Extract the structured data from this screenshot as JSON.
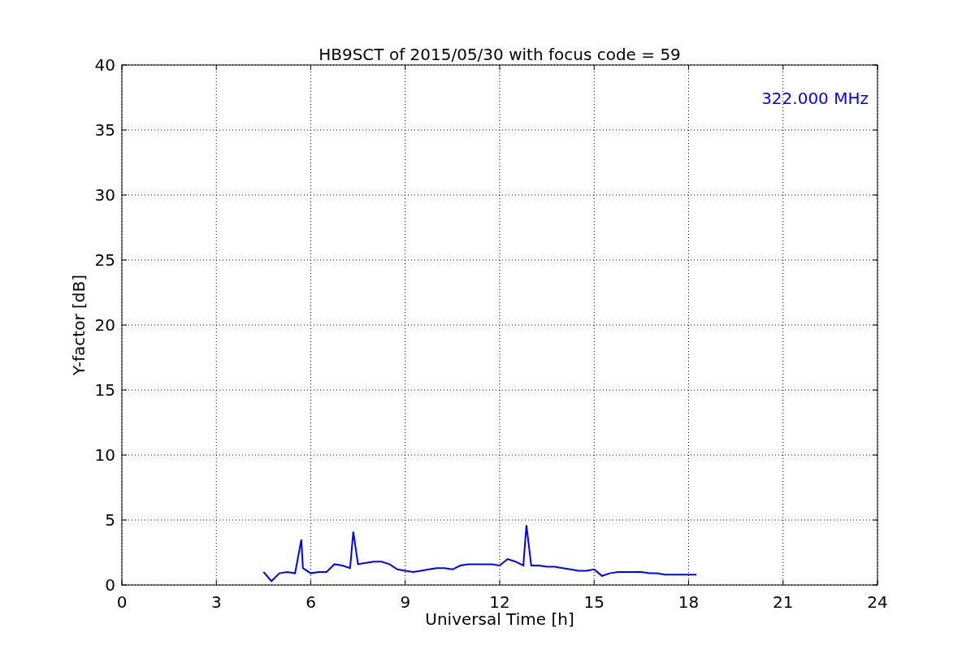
{
  "chart_data": {
    "type": "line",
    "title": "HB9SCT of 2015/05/30 with focus code = 59",
    "xlabel": "Universal Time [h]",
    "ylabel": "Y-factor [dB]",
    "x": [
      4.5,
      4.75,
      5.0,
      5.25,
      5.5,
      5.7,
      5.75,
      6.0,
      6.25,
      6.5,
      6.75,
      7.0,
      7.25,
      7.35,
      7.5,
      7.75,
      8.0,
      8.25,
      8.5,
      8.75,
      9.0,
      9.25,
      9.5,
      9.75,
      10.0,
      10.25,
      10.5,
      10.75,
      11.0,
      11.25,
      11.5,
      11.75,
      12.0,
      12.25,
      12.5,
      12.75,
      12.85,
      13.0,
      13.25,
      13.5,
      13.75,
      14.0,
      14.25,
      14.5,
      14.75,
      15.0,
      15.25,
      15.5,
      15.75,
      16.0,
      16.25,
      16.5,
      16.75,
      17.0,
      17.25,
      17.5,
      17.75,
      18.0,
      18.25
    ],
    "series": [
      {
        "name": "322.000 MHz",
        "color": "#0000ff",
        "values": [
          1.0,
          0.3,
          0.9,
          1.0,
          0.9,
          3.5,
          1.3,
          0.9,
          1.0,
          1.0,
          1.6,
          1.5,
          1.3,
          4.1,
          1.6,
          1.7,
          1.8,
          1.8,
          1.6,
          1.2,
          1.1,
          1.0,
          1.1,
          1.2,
          1.3,
          1.3,
          1.2,
          1.5,
          1.6,
          1.6,
          1.6,
          1.6,
          1.5,
          2.0,
          1.8,
          1.5,
          4.6,
          1.5,
          1.5,
          1.4,
          1.4,
          1.3,
          1.2,
          1.1,
          1.1,
          1.2,
          0.7,
          0.9,
          1.0,
          1.0,
          1.0,
          1.0,
          0.9,
          0.9,
          0.8,
          0.8,
          0.8,
          0.8,
          0.8
        ]
      }
    ],
    "xlim": [
      0,
      24
    ],
    "ylim": [
      0,
      40
    ],
    "xticks": [
      0,
      3,
      6,
      9,
      12,
      15,
      18,
      21,
      24
    ],
    "yticks": [
      0,
      5,
      10,
      15,
      20,
      25,
      30,
      35,
      40
    ],
    "grid": true
  }
}
